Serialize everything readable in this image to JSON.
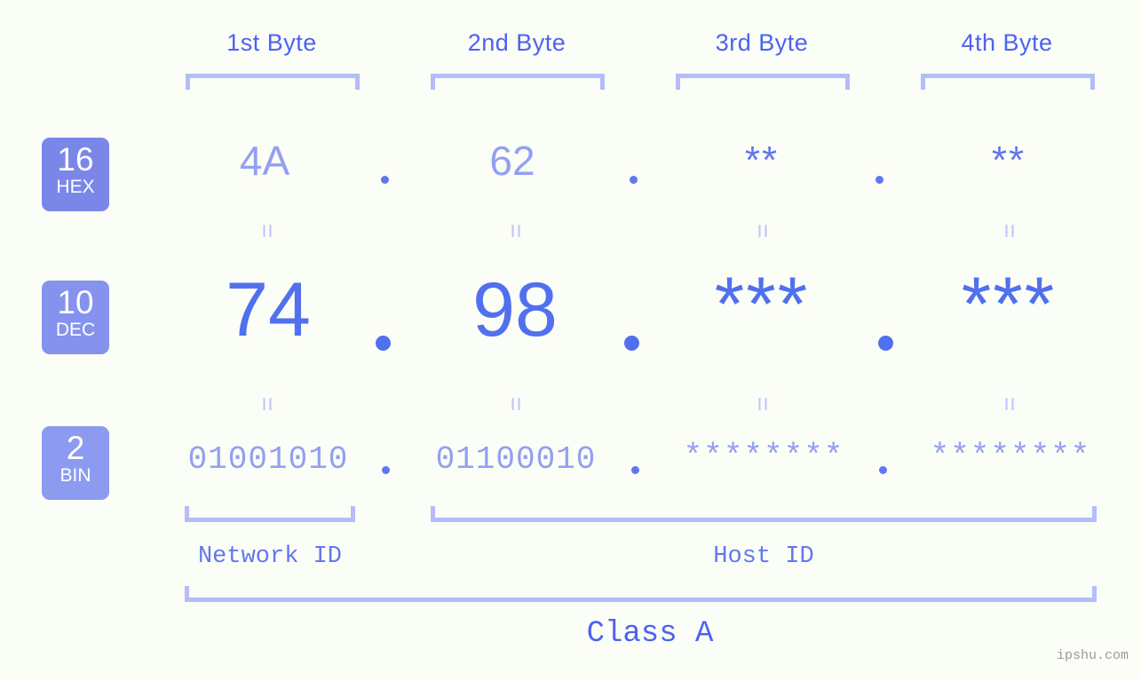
{
  "background_color": "#fbfdf7",
  "accent_colors": {
    "strong_blue": "#4c63f0",
    "mid_blue": "#5070ef",
    "light_blue": "#93a0ef",
    "bracket": "#b3bdfa",
    "badge_hex": "#7b87e8",
    "badge_dec": "#8592ee",
    "badge_bin": "#8c9bf0"
  },
  "header": {
    "bytes": [
      {
        "label": "1st Byte"
      },
      {
        "label": "2nd Byte"
      },
      {
        "label": "3rd Byte"
      },
      {
        "label": "4th Byte"
      }
    ]
  },
  "rows": [
    {
      "key": "hex",
      "badge": {
        "number": "16",
        "name": "HEX",
        "color": "#7b87e8"
      },
      "values": [
        "4A",
        "62",
        "**",
        "**"
      ],
      "separator": "."
    },
    {
      "key": "dec",
      "badge": {
        "number": "10",
        "name": "DEC",
        "color": "#8592ee"
      },
      "values": [
        "74",
        "98",
        "***",
        "***"
      ],
      "separator": "."
    },
    {
      "key": "bin",
      "badge": {
        "number": "2",
        "name": "BIN",
        "color": "#8c9bf0"
      },
      "values": [
        "01001010",
        "01100010",
        "********",
        "********"
      ],
      "separator": "."
    }
  ],
  "connectors": {
    "symbol": "=",
    "count_per_gap": 4
  },
  "footer": {
    "network_id_label": "Network ID",
    "host_id_label": "Host ID",
    "class_label": "Class A"
  },
  "watermark": {
    "text": "ipshu.com"
  }
}
